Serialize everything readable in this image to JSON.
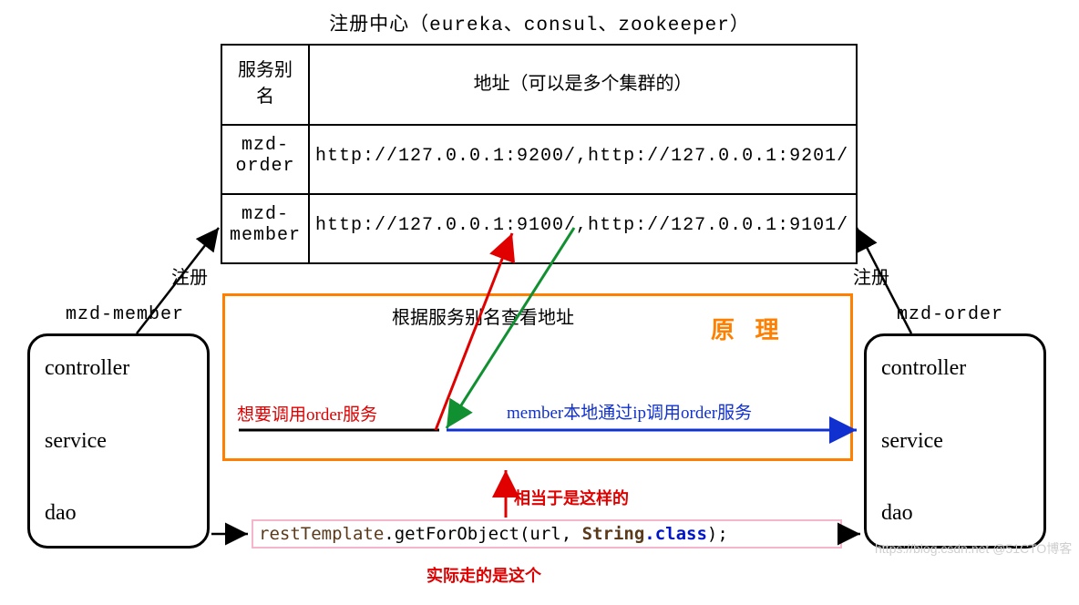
{
  "registry": {
    "title": "注册中心（eureka、consul、zookeeper）",
    "headers": {
      "alias": "服务别名",
      "address": "地址（可以是多个集群的）"
    },
    "rows": [
      {
        "alias": "mzd-order",
        "address": "http://127.0.0.1:9200/,http://127.0.0.1:9201/"
      },
      {
        "alias": "mzd-member",
        "address": "http://127.0.0.1:9100/,http://127.0.0.1:9101/"
      }
    ]
  },
  "labels": {
    "register_left": "注册",
    "register_right": "注册",
    "member_service": "mzd-member",
    "order_service": "mzd-order"
  },
  "service_layers": {
    "l1": "controller",
    "l2": "service",
    "l3": "dao"
  },
  "principle": {
    "title": "根据服务别名查看地址",
    "badge": "原 理",
    "red_text": "想要调用order服务",
    "blue_text": "member本地通过ip调用order服务"
  },
  "code": {
    "obj": "restTemplate",
    "method": ".getForObject(url, ",
    "str": "String",
    "kw": ".class",
    "tail": ");"
  },
  "captions": {
    "above_code": "相当于是这样的",
    "below_code": "实际走的是这个"
  },
  "watermark": "https://blog.csdn.net @51CTO博客"
}
